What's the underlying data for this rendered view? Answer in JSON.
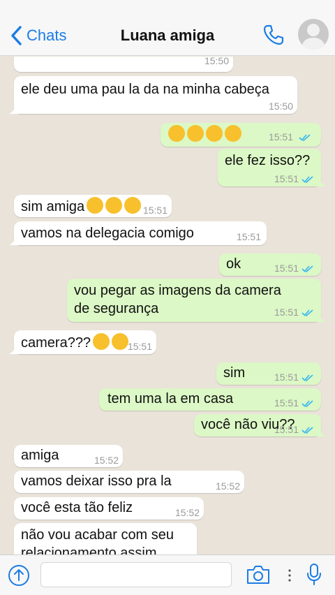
{
  "header": {
    "back_label": "Chats",
    "title": "Luana amiga"
  },
  "colors": {
    "accent": "#1a7ce4",
    "incoming": "#ffffff",
    "outgoing": "#dcf8c6",
    "read_ticks": "#34b7f1"
  },
  "messages": [
    {
      "dir": "in",
      "text": "",
      "time": "15:50"
    },
    {
      "dir": "in",
      "text": "ele deu uma pau la da na minha cabeça",
      "time": "15:50"
    },
    {
      "dir": "out",
      "text": "😱😱😱😱",
      "time": "15:51"
    },
    {
      "dir": "out",
      "text": "ele fez isso??",
      "time": "15:51"
    },
    {
      "dir": "in",
      "text": "sim amiga 😭😭😭",
      "time": "15:51"
    },
    {
      "dir": "in",
      "text": "vamos na delegacia comigo",
      "time": "15:51"
    },
    {
      "dir": "out",
      "text": "ok",
      "time": "15:51"
    },
    {
      "dir": "out",
      "line1": "vou pegar as imagens da camera",
      "line2": "de segurança",
      "time": "15:51"
    },
    {
      "dir": "in",
      "text": "camera??? 😳😳",
      "time": "15:51"
    },
    {
      "dir": "out",
      "text": "sim",
      "time": "15:51"
    },
    {
      "dir": "out",
      "text": "tem uma la em casa",
      "time": "15:51"
    },
    {
      "dir": "out",
      "text": "você não viu??",
      "time": "15:51"
    },
    {
      "dir": "in",
      "text": "amiga",
      "time": "15:52"
    },
    {
      "dir": "in",
      "text": "vamos deixar isso pra la",
      "time": "15:52"
    },
    {
      "dir": "in",
      "text": "você esta tão feliz",
      "time": "15:52"
    },
    {
      "dir": "in",
      "line1": "não vou acabar com seu",
      "line2": "relacionamento assim"
    }
  ],
  "footer": {
    "input_value": ""
  }
}
